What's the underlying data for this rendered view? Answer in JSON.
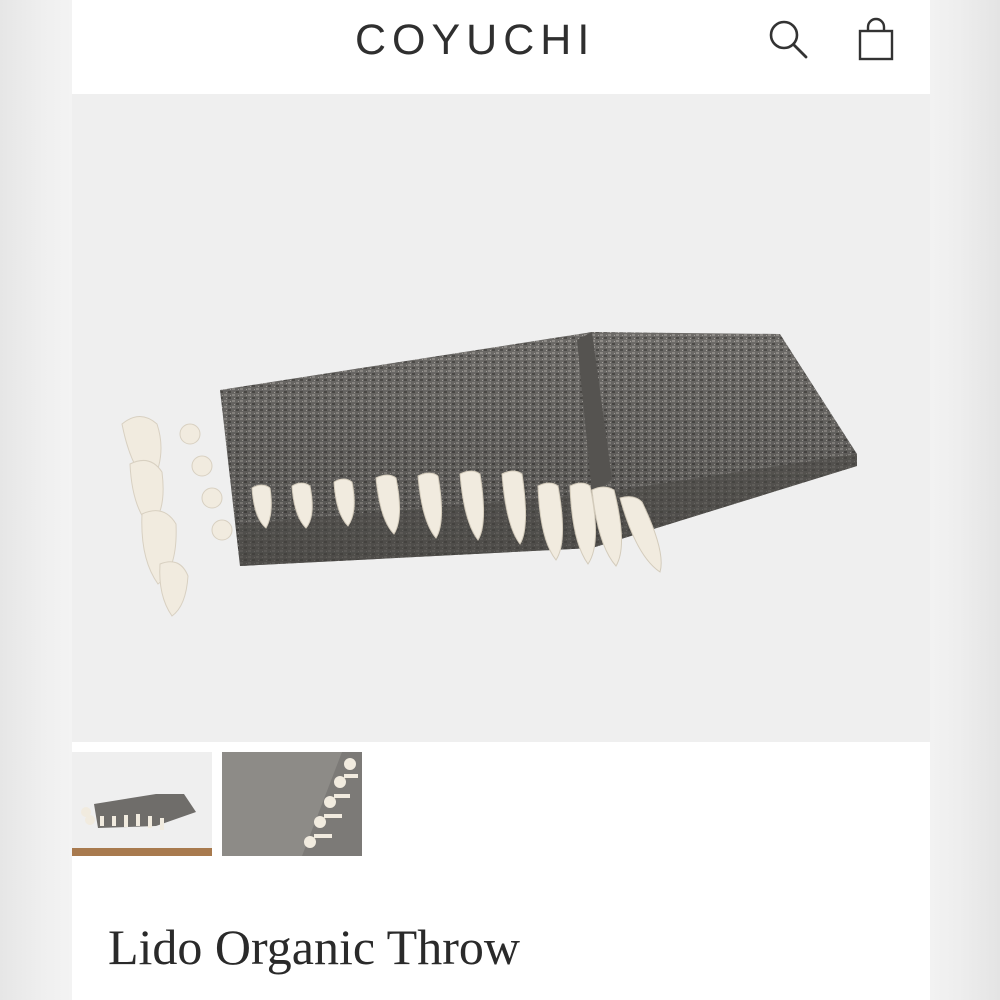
{
  "header": {
    "logo": "COYUCHI",
    "search_icon": "search-icon",
    "bag_icon": "shopping-bag-icon"
  },
  "gallery": {
    "thumbnails": [
      {
        "name": "product-full-view",
        "selected": true
      },
      {
        "name": "product-detail-closeup",
        "selected": false
      }
    ],
    "active_indicator_color": "#a87a4e"
  },
  "product": {
    "title": "Lido Organic Throw"
  },
  "colors": {
    "background": "#ffffff",
    "hero_background": "#efefef",
    "text": "#2a2a2a",
    "throw_gray": "#6e6c69",
    "tassel_cream": "#f1ebdf"
  }
}
